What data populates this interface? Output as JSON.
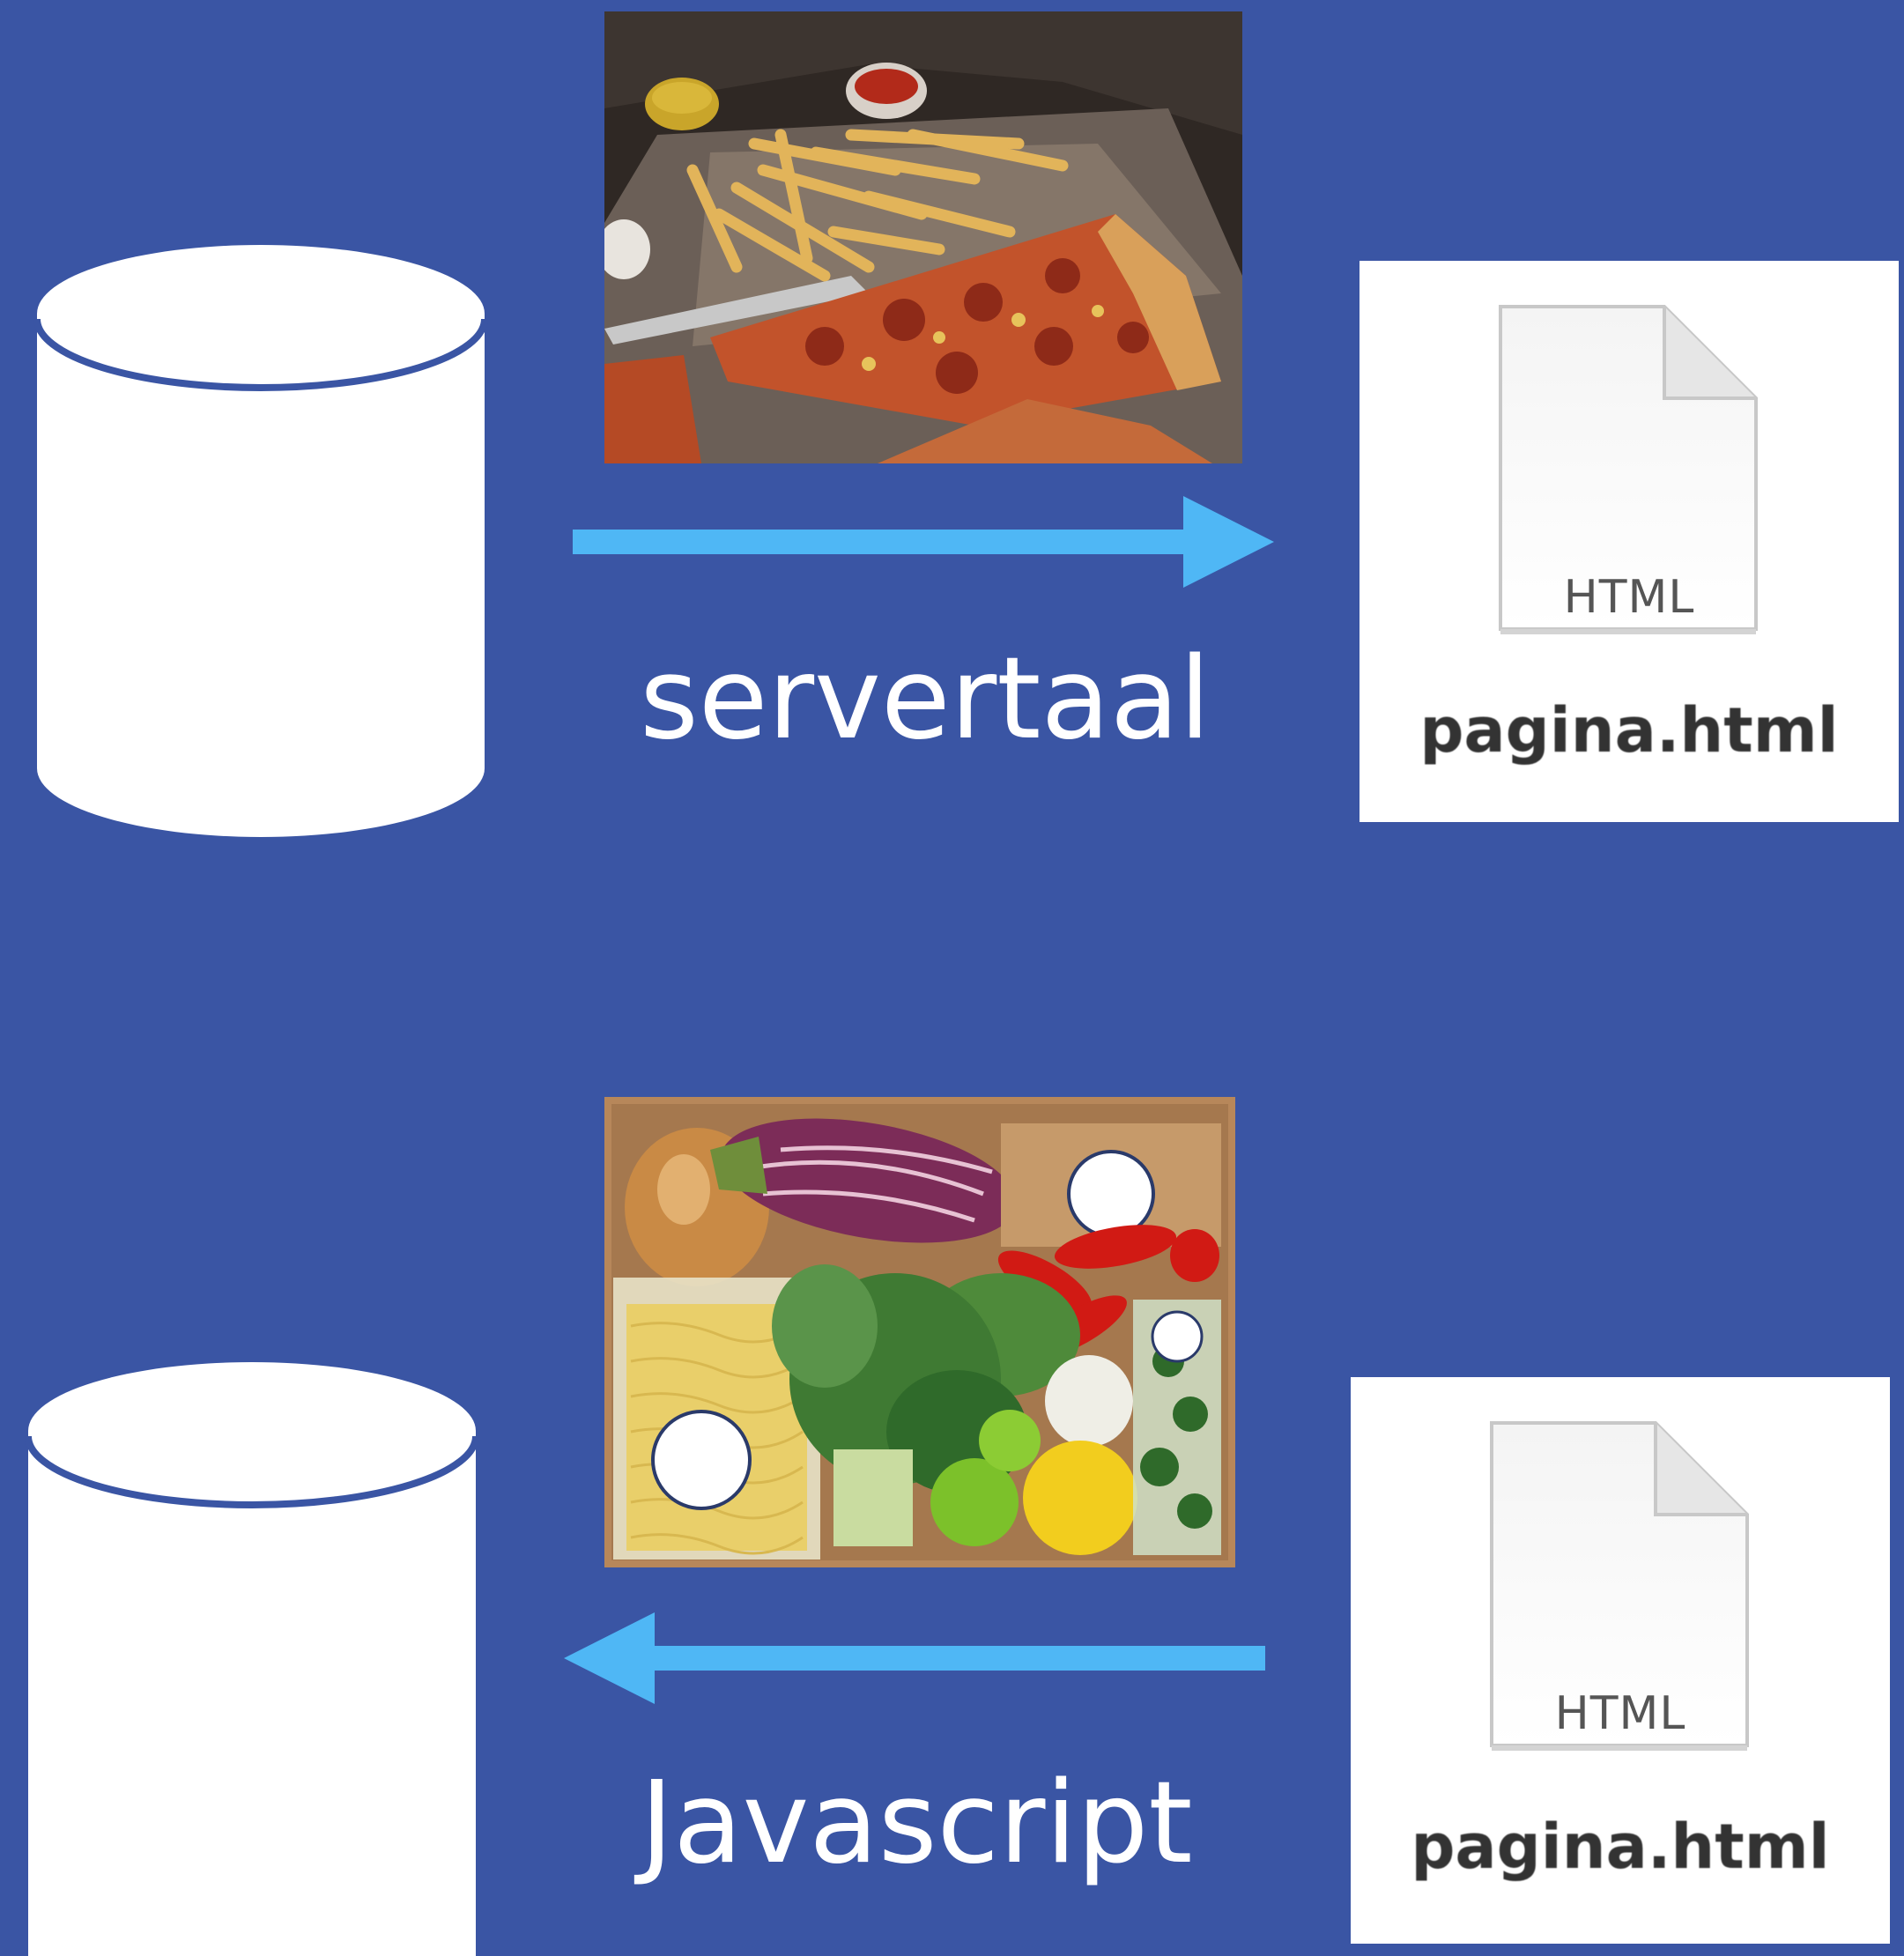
{
  "colors": {
    "background": "#3a55a4",
    "arrow": "#4fb7f5",
    "cylinder": "#ffffff",
    "card": "#ffffff"
  },
  "top_flow": {
    "label": "servertaal",
    "direction": "right",
    "image": "pizza-and-fries-photo",
    "file": {
      "type": "HTML",
      "name": "pagina.html"
    }
  },
  "bottom_flow": {
    "label": "Javascript",
    "direction": "left",
    "image": "meal-kit-box-photo",
    "file": {
      "type": "HTML",
      "name": "pagina.html"
    }
  },
  "icons": [
    "database-icon",
    "html-file-icon"
  ]
}
